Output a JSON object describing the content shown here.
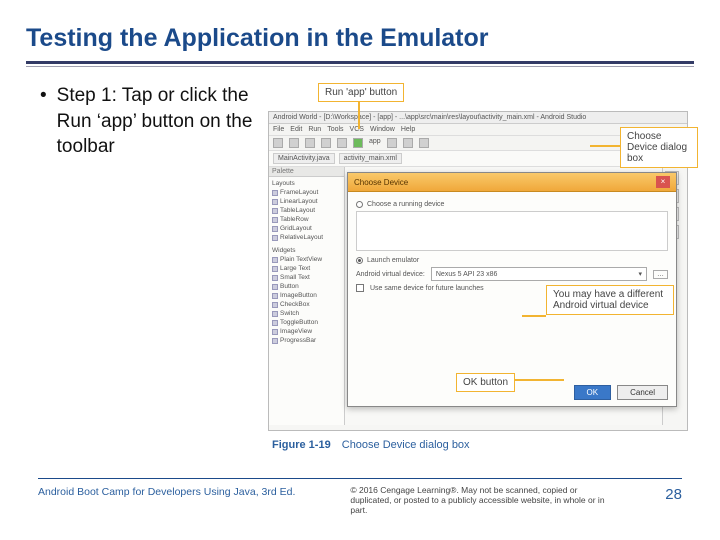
{
  "title": "Testing the Application in the Emulator",
  "bullet": {
    "text": "Step 1:  Tap or click the Run ‘app’ button on the toolbar"
  },
  "callouts": {
    "runApp": "Run 'app' button",
    "chooseDeviceBox": "Choose Device dialog box",
    "virtualDevice": "You may have a different Android virtual device",
    "okButton": "OK button"
  },
  "ide": {
    "title": "Android World - [D:\\Workspace] - [app] - ...\\app\\src\\main\\res\\layout\\activity_main.xml - Android Studio",
    "menus": [
      "File",
      "Edit",
      "Run",
      "Tools",
      "VCS",
      "Window",
      "Help"
    ],
    "run_config": "app",
    "tabs": [
      "MainActivity.java",
      "activity_main.xml"
    ],
    "palette": {
      "header": "Palette",
      "group_layouts": "Layouts",
      "layouts": [
        "FrameLayout",
        "LinearLayout",
        "TableLayout",
        "TableRow",
        "GridLayout",
        "RelativeLayout"
      ],
      "group_widgets": "Widgets",
      "widgets": [
        "Plain TextView",
        "Large Text",
        "Small Text",
        "Button",
        "ImageButton",
        "CheckBox",
        "Switch",
        "ToggleButton",
        "ImageView",
        "ProgressBar"
      ]
    }
  },
  "dialog": {
    "title": "Choose Device",
    "opt_running": "Choose a running device",
    "opt_launch": "Launch emulator",
    "avd_label": "Android virtual device:",
    "avd_value": "Nexus 5 API 23  x86",
    "same_device": "Use same device for future launches",
    "ok": "OK",
    "cancel": "Cancel"
  },
  "figure": {
    "number": "Figure 1-19",
    "caption": "Choose Device dialog box"
  },
  "footer": {
    "book": "Android Boot Camp for Developers Using Java, 3rd Ed.",
    "copyright": "© 2016 Cengage Learning®. May not be scanned, copied or duplicated, or posted to a publicly accessible website, in whole or in part.",
    "page": "28"
  }
}
